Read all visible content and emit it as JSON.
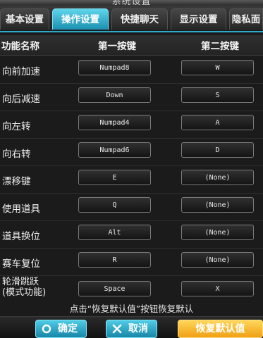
{
  "window": {
    "title": "系统设置"
  },
  "tabs": [
    {
      "label": "基本设置"
    },
    {
      "label": "操作设置"
    },
    {
      "label": "快捷聊天"
    },
    {
      "label": "显示设置"
    },
    {
      "label": "隐私面"
    }
  ],
  "active_tab": "操作设置",
  "columns": {
    "name": "功能名称",
    "primary": "第一按键",
    "secondary": "第二按键"
  },
  "bindings": [
    {
      "name": "向前加速",
      "primary": "Numpad8",
      "secondary": "W"
    },
    {
      "name": "向后减速",
      "primary": "Down",
      "secondary": "S"
    },
    {
      "name": "向左转",
      "primary": "Numpad4",
      "secondary": "A"
    },
    {
      "name": "向右转",
      "primary": "Numpad6",
      "secondary": "D"
    },
    {
      "name": "漂移键",
      "primary": "E",
      "secondary": "(None)"
    },
    {
      "name": "使用道具",
      "primary": "Q",
      "secondary": "(None)"
    },
    {
      "name": "道具换位",
      "primary": "Alt",
      "secondary": "(None)"
    },
    {
      "name": "赛车复位",
      "primary": "R",
      "secondary": "(None)"
    },
    {
      "name": "轮滑跳跃",
      "name2": "(模式功能)",
      "primary": "Space",
      "secondary": "X"
    }
  ],
  "hint": "点击“恢复默认值”按钮恢复默认",
  "buttons": {
    "ok": "确定",
    "cancel": "取消",
    "restore": "恢复默认值"
  },
  "colors": {
    "accent": "#2ea8c6",
    "restore": "#f0a015"
  }
}
